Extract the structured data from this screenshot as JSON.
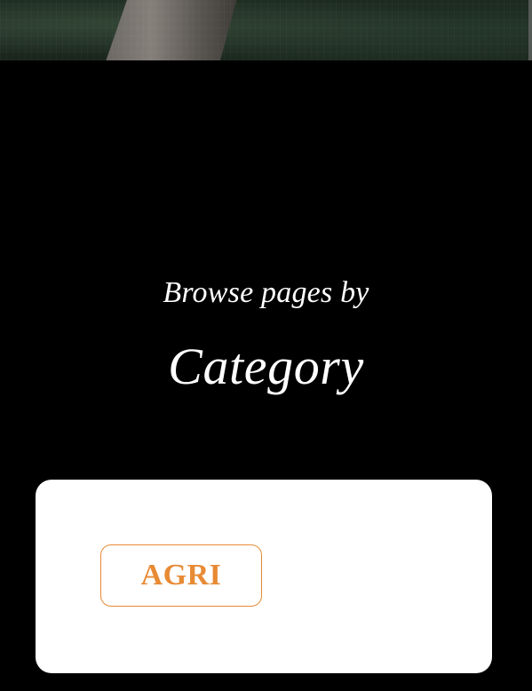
{
  "header": {
    "image_description": "hero-image"
  },
  "browse": {
    "subtitle": "Browse pages by",
    "title": "Category"
  },
  "categories": {
    "items": [
      {
        "label": "AGRI"
      }
    ]
  },
  "colors": {
    "background": "#000000",
    "card": "#ffffff",
    "accent": "#e88a34",
    "text_on_dark": "#ffffff"
  }
}
